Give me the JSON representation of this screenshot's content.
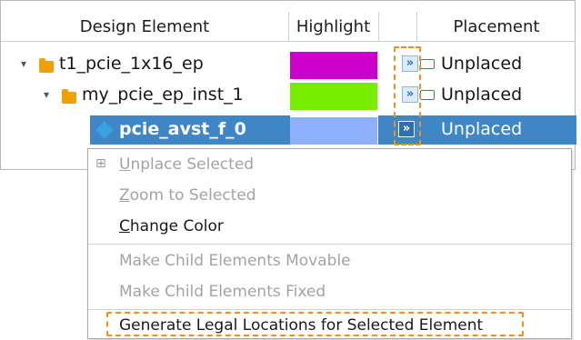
{
  "columns": {
    "design_element": "Design Element",
    "highlight": "Highlight",
    "placement": "Placement"
  },
  "rows": [
    {
      "name": "t1_pcie_1x16_ep",
      "highlight_color": "#cc00cc",
      "placement": "Unplaced",
      "expanded": true,
      "icon": "folder-icon"
    },
    {
      "name": "my_pcie_ep_inst_1",
      "highlight_color": "#77ee00",
      "placement": "Unplaced",
      "expanded": true,
      "icon": "folder-icon"
    },
    {
      "name": "pcie_avst_f_0",
      "highlight_color": "#8fb0ff",
      "placement": "Unplaced",
      "selected": true,
      "icon": "cube-icon"
    }
  ],
  "menu": {
    "items": [
      {
        "label": "Unplace Selected",
        "enabled": false,
        "underline_char": "U",
        "icon": "unplace-icon"
      },
      {
        "label": "Zoom to Selected",
        "enabled": false,
        "underline_char": "Z"
      },
      {
        "label": "Change Color",
        "enabled": true,
        "underline_char": "C"
      },
      {
        "label": "Make Child Elements Movable",
        "enabled": false
      },
      {
        "label": "Make Child Elements Fixed",
        "enabled": false
      },
      {
        "label": "Generate Legal Locations for Selected Element",
        "enabled": true,
        "highlighted_box": true
      }
    ]
  },
  "colors": {
    "selection": "#3f86c6",
    "annotation": "#f0901e",
    "folder": "#f0a000"
  }
}
